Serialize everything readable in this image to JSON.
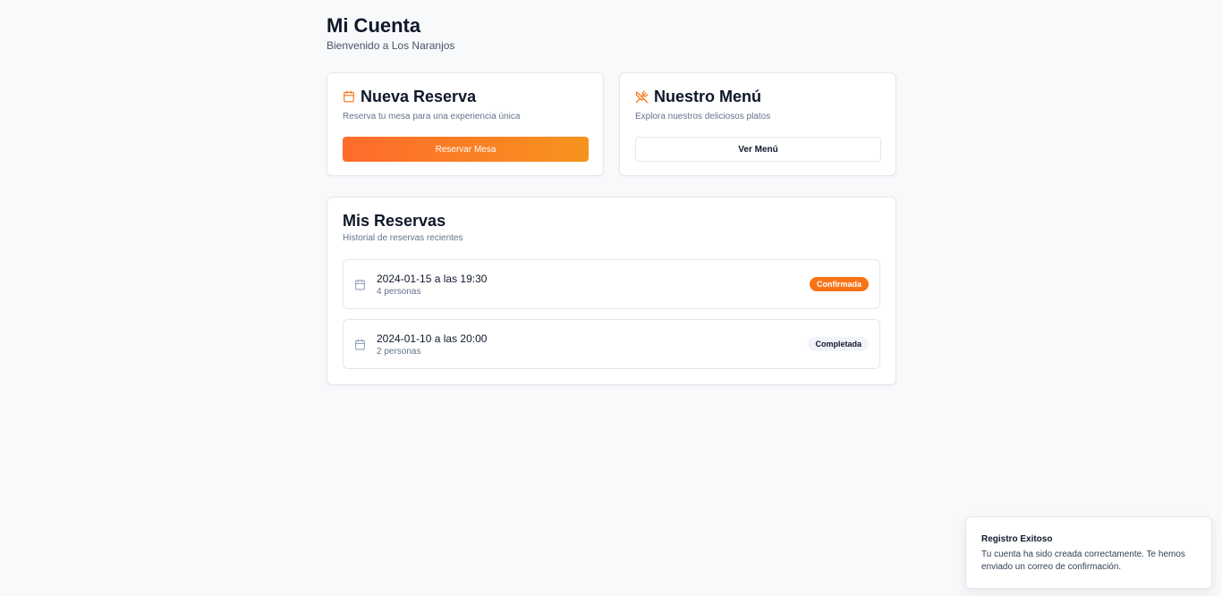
{
  "header": {
    "title": "Mi Cuenta",
    "subtitle": "Bienvenido a Los Naranjos"
  },
  "cards": {
    "reserve": {
      "icon": "calendar-icon",
      "title": "Nueva Reserva",
      "description": "Reserva tu mesa para una experiencia única",
      "button_label": "Reservar Mesa"
    },
    "menu": {
      "icon": "utensils-crossed-icon",
      "title": "Nuestro Menú",
      "description": "Explora nuestros deliciosos platos",
      "button_label": "Ver Menú"
    }
  },
  "reservations": {
    "title": "Mis Reservas",
    "subtitle": "Historial de reservas recientes",
    "items": [
      {
        "datetime": "2024-01-15 a las 19:30",
        "people": "4 personas",
        "status": "Confirmada",
        "status_color": "#f97316"
      },
      {
        "datetime": "2024-01-10 a las 20:00",
        "people": "2 personas",
        "status": "Completada",
        "status_color": "#f1f5f9"
      }
    ]
  },
  "toast": {
    "title": "Registro Exitoso",
    "message": "Tu cuenta ha sido creada correctamente. Te hemos enviado un correo de confirmación."
  },
  "colors": {
    "accent": "#f97316",
    "gradient_start": "#ff6b2c",
    "gradient_end": "#f7931e"
  }
}
